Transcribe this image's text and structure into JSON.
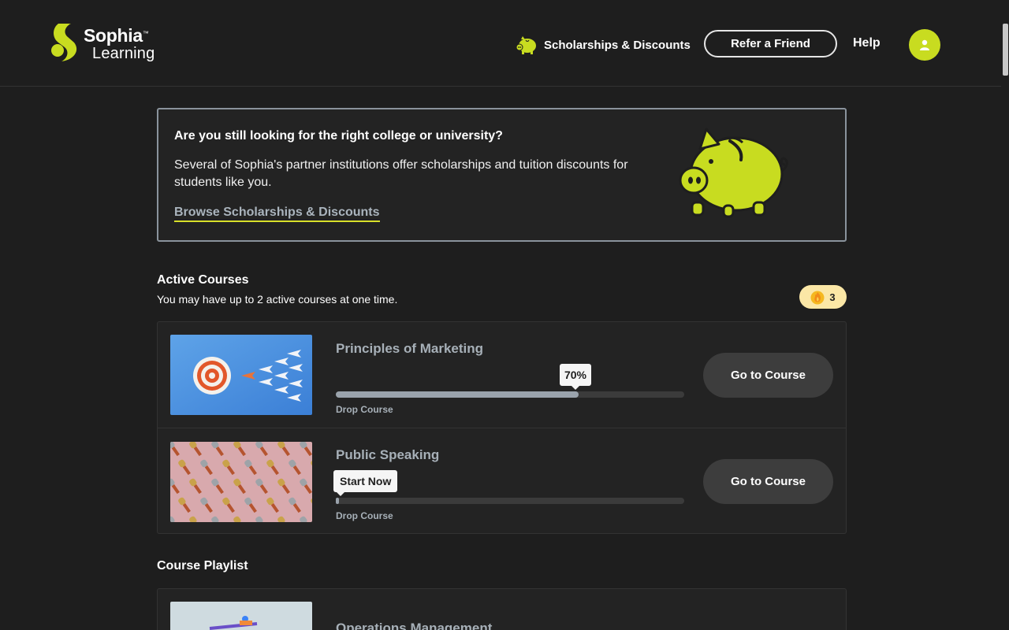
{
  "header": {
    "logo_line1": "Sophia",
    "logo_tm": "™",
    "logo_line2": "Learning",
    "scholarships_label": "Scholarships & Discounts",
    "refer_label": "Refer a Friend",
    "help_label": "Help",
    "avatar_icon": "user-icon",
    "brand_color": "#c8dc20"
  },
  "promo": {
    "title": "Are you still looking for the right college or university?",
    "body": "Several of Sophia's partner institutions offer scholarships and tuition discounts for students like you.",
    "link": "Browse Scholarships & Discounts",
    "image_icon": "piggy-bank-icon"
  },
  "active_courses": {
    "title": "Active Courses",
    "subtitle": "You may have up to 2 active courses at one time.",
    "streak_count": "3",
    "streak_icon": "flame-icon",
    "courses": [
      {
        "name": "Principles of Marketing",
        "progress_label": "70%",
        "progress_percent": 70,
        "drop_label": "Drop Course",
        "go_label": "Go to Course",
        "thumbnail_icon": "target-paper-planes-image"
      },
      {
        "name": "Public Speaking",
        "progress_label": "Start Now",
        "progress_percent": 0,
        "drop_label": "Drop Course",
        "go_label": "Go to Course",
        "thumbnail_icon": "microphones-image"
      }
    ]
  },
  "playlist": {
    "title": "Course Playlist",
    "courses": [
      {
        "name": "Operations Management",
        "thumbnail_icon": "operations-image"
      }
    ]
  }
}
